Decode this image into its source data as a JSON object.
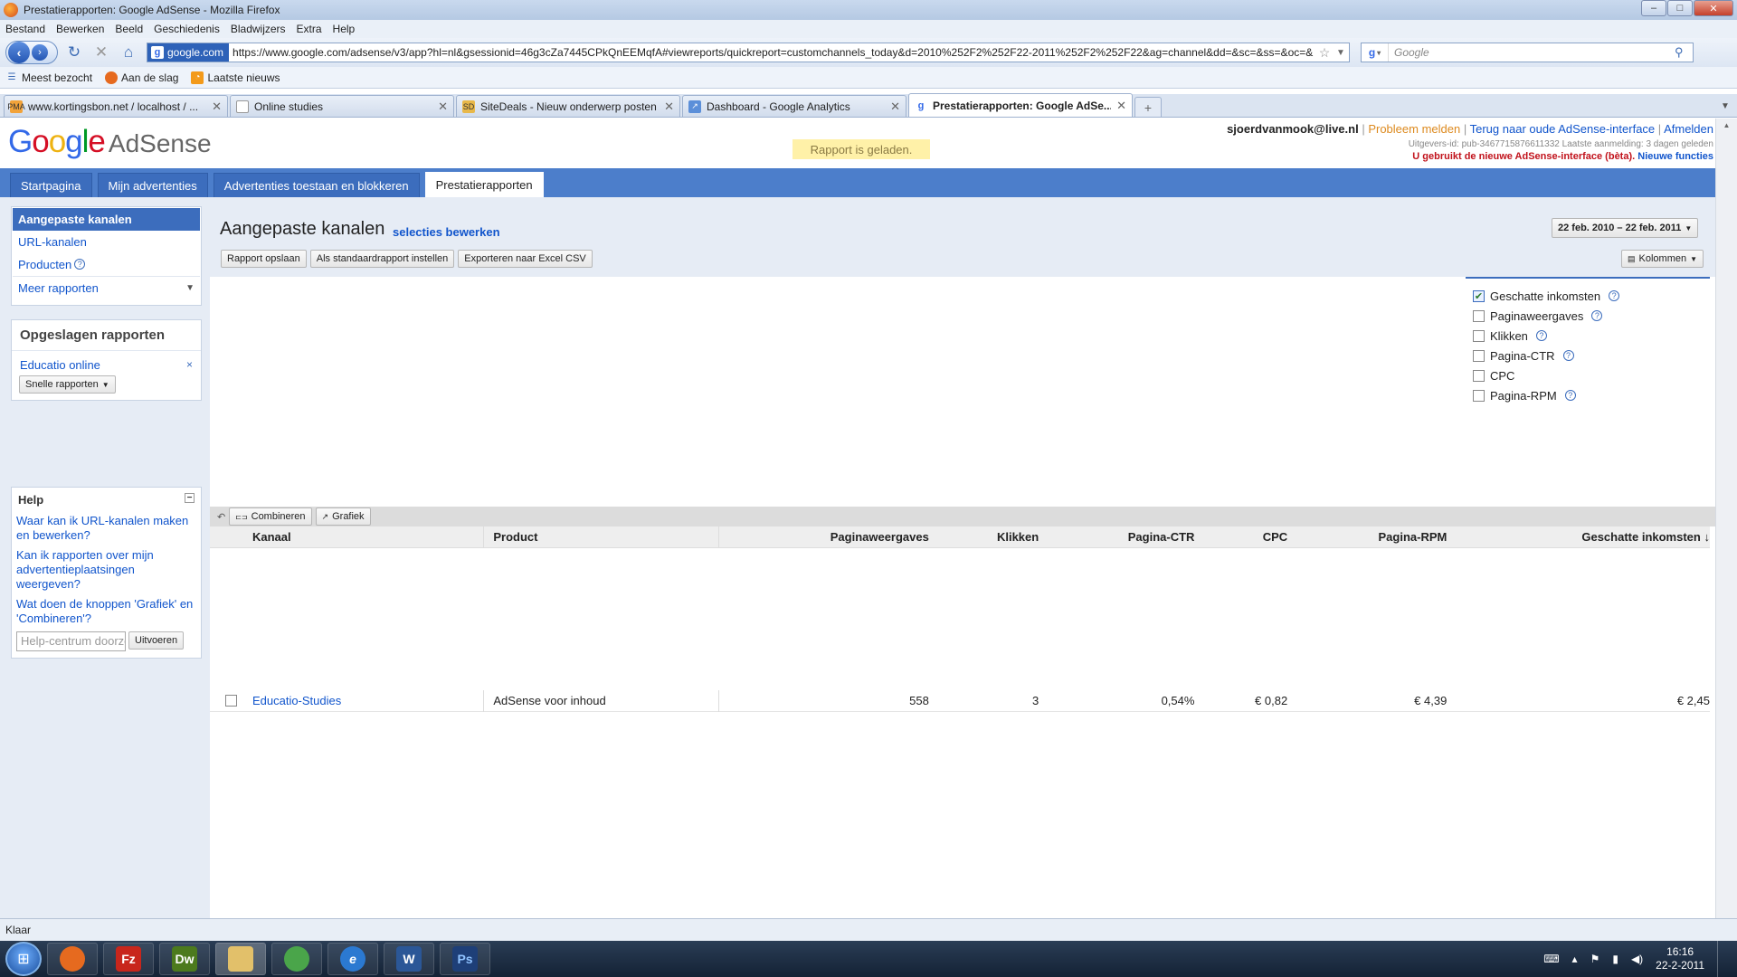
{
  "window": {
    "title": "Prestatierapporten: Google AdSense - Mozilla Firefox",
    "min": "–",
    "max": "□",
    "close": "✕"
  },
  "menu": [
    "Bestand",
    "Bewerken",
    "Beeld",
    "Geschiedenis",
    "Bladwijzers",
    "Extra",
    "Help"
  ],
  "nav": {
    "site_identity": "google.com",
    "url": "https://www.google.com/adsense/v3/app?hl=nl&gsessionid=46g3cZa7445CPkQnEEMqfA#viewreports/quickreport=customchannels_today&d=2010%252F2%252F22-2011%252F2%252F22&ag=channel&dd=&sc=&ss=&oc=&",
    "search_placeholder": "Google"
  },
  "bookmarks": [
    "Meest bezocht",
    "Aan de slag",
    "Laatste nieuws"
  ],
  "tabs": [
    {
      "label": "www.kortingsbon.net / localhost / ...",
      "icon_text": "PMA",
      "icon_color": "#f2a33a"
    },
    {
      "label": "Online studies",
      "icon_text": "",
      "icon_color": "#ffffff"
    },
    {
      "label": "SiteDeals - Nieuw onderwerp posten",
      "icon_text": "SD",
      "icon_color": "#e8b84a"
    },
    {
      "label": "Dashboard - Google Analytics",
      "icon_text": "",
      "icon_color": "#5b8fd9"
    },
    {
      "label": "Prestatierapporten: Google AdSe...",
      "icon_text": "g",
      "icon_color": "#ffffff"
    }
  ],
  "header": {
    "logo_google": [
      "G",
      "o",
      "o",
      "g",
      "l",
      "e"
    ],
    "logo_adsense": "AdSense",
    "loaded_msg": "Rapport is geladen.",
    "email": "sjoerdvanmook@live.nl",
    "link_report": "Probleem melden",
    "link_old": "Terug naar oude AdSense-interface",
    "link_logout": "Afmelden",
    "publisher_meta": "Uitgevers-id: pub-3467715876611332   Laatste aanmelding: 3 dagen geleden",
    "warning": "U gebruikt de nieuwe AdSense-interface (bèta).",
    "new_features": "Nieuwe functies"
  },
  "main_tabs": [
    "Startpagina",
    "Mijn advertenties",
    "Advertenties toestaan en blokkeren",
    "Prestatierapporten"
  ],
  "sidebar": {
    "items": [
      "Aangepaste kanalen",
      "URL-kanalen",
      "Producten",
      "Meer rapporten"
    ],
    "saved_title": "Opgeslagen rapporten",
    "saved_item": "Educatio online",
    "quick_reports": "Snelle rapporten",
    "help_title": "Help",
    "help_links": [
      "Waar kan ik URL-kanalen maken en bewerken?",
      "Kan ik rapporten over mijn advertentieplaatsingen weergeven?",
      "Wat doen de knoppen 'Grafiek' en 'Combineren'?"
    ],
    "help_placeholder": "Help-centrum doorzoeken",
    "help_go": "Uitvoeren"
  },
  "report": {
    "title": "Aangepaste kanalen",
    "edit_link": "selecties bewerken",
    "date_range": "22 feb. 2010 – 22 feb. 2011",
    "actions": [
      "Rapport opslaan",
      "Als standaardrapport instellen",
      "Exporteren naar Excel CSV"
    ],
    "columns_btn": "Kolommen",
    "metrics": [
      {
        "label": "Geschatte inkomsten",
        "checked": true
      },
      {
        "label": "Paginaweergaves",
        "checked": false
      },
      {
        "label": "Klikken",
        "checked": false
      },
      {
        "label": "Pagina-CTR",
        "checked": false
      },
      {
        "label": "CPC",
        "checked": false
      },
      {
        "label": "Pagina-RPM",
        "checked": false
      }
    ],
    "toolbar": [
      "Combineren",
      "Grafiek"
    ],
    "table": {
      "headers": [
        "Kanaal",
        "Product",
        "Paginaweergaves",
        "Klikken",
        "Pagina-CTR",
        "CPC",
        "Pagina-RPM",
        "Geschatte inkomsten ↓"
      ],
      "rows": [
        [
          "Educatio-Studies",
          "AdSense voor inhoud",
          "558",
          "3",
          "0,54%",
          "€ 0,82",
          "€ 4,39",
          "€ 2,45"
        ]
      ]
    }
  },
  "status": "Klaar",
  "taskbar": {
    "apps": [
      {
        "name": "firefox",
        "label": "",
        "color": "#e66a1f"
      },
      {
        "name": "filezilla",
        "label": "Fz",
        "color": "#c8261c"
      },
      {
        "name": "dreamweaver",
        "label": "Dw",
        "color": "#4c7a1d"
      },
      {
        "name": "explorer",
        "label": "",
        "color": "#e2c06a"
      },
      {
        "name": "messenger",
        "label": "",
        "color": "#4aa54a"
      },
      {
        "name": "ie",
        "label": "e",
        "color": "#2b79d1"
      },
      {
        "name": "word",
        "label": "W",
        "color": "#2b5797"
      },
      {
        "name": "photoshop",
        "label": "Ps",
        "color": "#1e3f78"
      }
    ],
    "time": "16:16",
    "date": "22-2-2011"
  }
}
